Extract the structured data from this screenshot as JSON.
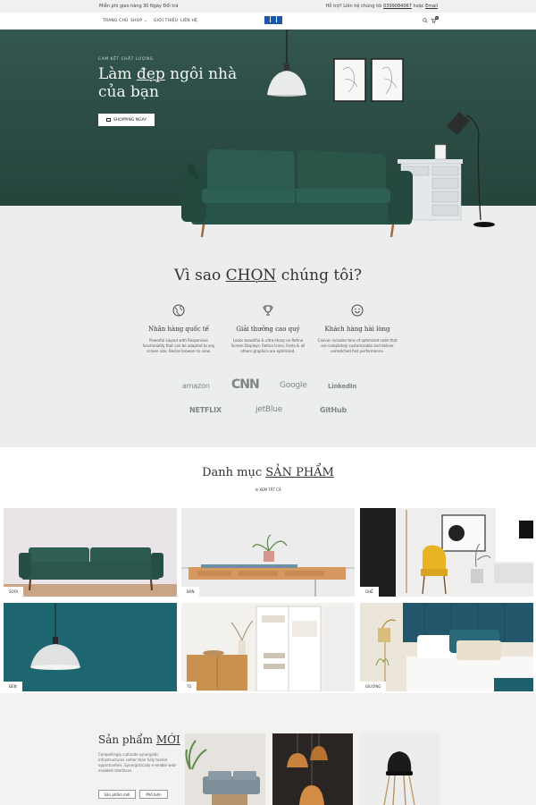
{
  "topbar": {
    "shipping": "Miễn phí giao hàng",
    "returns": "30 Ngày Đổi trả",
    "support_prefix": "Hỗ trợ? Liên hệ chúng tôi",
    "phone": "0399084067",
    "support_or": "hoặc",
    "email": "Email"
  },
  "nav": {
    "items": [
      "Trang chủ",
      "Shop",
      "Giới thiệu",
      "Liên hệ"
    ],
    "search_icon": "search-icon",
    "cart_icon": "cart-icon",
    "cart_count": "0"
  },
  "hero": {
    "kicker": "Cam kết chất lượng",
    "title_1": "Làm ",
    "title_2": "đẹp",
    "title_3": " ngôi nhà của bạn",
    "cta": "Shopping Ngay"
  },
  "why": {
    "title_1": "Vì sao ",
    "title_2": "CHỌN",
    "title_3": " chúng tôi?",
    "features": [
      {
        "icon": "globe-icon",
        "title": "Nhãn hàng quốc tế",
        "desc": "Powerful Layout with Responsive functionality that can be adapted to any screen size. Resize browser to view."
      },
      {
        "icon": "trophy-icon",
        "title": "Giải thưởng cao quý",
        "desc": "Looks beautiful & ultra-sharp on Retina Screen Displays. Retina Icons, Fonts & all others graphics are optimized."
      },
      {
        "icon": "smiley-icon",
        "title": "Khách hàng hài lòng",
        "desc": "Canvas includes tons of optimized code that are completely customizable and deliver unmatched fast performance."
      }
    ],
    "brands": [
      "amazon",
      "CNN",
      "Google",
      "LinkedIn",
      "NETFLIX",
      "jetBlue",
      "GitHub"
    ]
  },
  "categories": {
    "title_1": "Danh mục ",
    "title_2": "SẢN PHẨM",
    "see_all": "Xem tất cả",
    "tiles": [
      "Sofa",
      "Bàn",
      "Ghế",
      "Đèn",
      "Tủ",
      "Giường"
    ]
  },
  "new_products": {
    "title_1": "Sản phẩm ",
    "title_2": "MỚI",
    "desc": "Compellingly cultivate synergistic infrastructures rather than fully tested opportunities. Synergistically e-enable web-enabled interfaces.",
    "tag_new": "Sản phẩm mới",
    "tag_popular": "Phổ biến"
  },
  "colors": {
    "hero_green": "#2f4f48",
    "sofa_green": "#2c5a50",
    "accent_blue": "#1e56a8"
  }
}
